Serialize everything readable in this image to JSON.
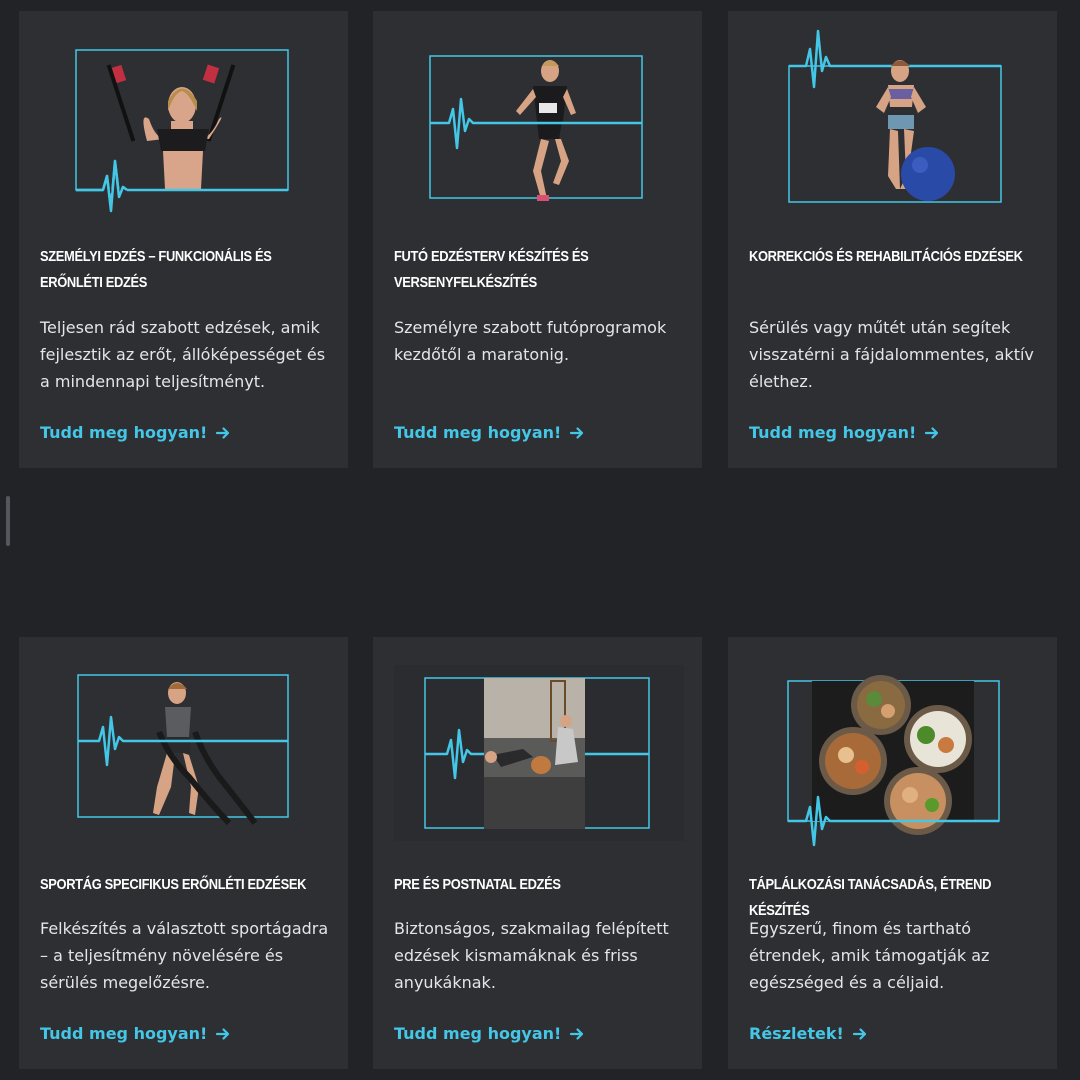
{
  "colors": {
    "background": "#222326",
    "card": "#2e2f33",
    "accent": "#44c6e6",
    "text": "#e4e5e8"
  },
  "cards": [
    {
      "title": "Személyi edzés – funkcionális és erőnléti edzés",
      "description": "Teljesen rád szabott edzések, amik fejlesztik az erőt, állóképességet és a mindennapi teljesítményt.",
      "link": "Tudd meg hogyan!",
      "icon": "arrow-right-icon"
    },
    {
      "title": "Futó edzésterv készítés és versenyfelkészítés",
      "description": "Személyre szabott futóprogramok kezdőtől a maratonig.",
      "link": "Tudd meg hogyan!",
      "icon": "arrow-right-icon"
    },
    {
      "title": "Korrekciós és rehabilitációs edzések",
      "description": "Sérülés vagy műtét után segítek visszatérni a fájdalommentes, aktív élethez.",
      "link": "Tudd meg hogyan!",
      "icon": "arrow-right-icon"
    },
    {
      "title": "Sportág specifikus erőnléti edzések",
      "description": "Felkészítés a választott sportágadra – a teljesítmény növelésére és sérülés megelőzésre.",
      "link": "Tudd meg hogyan!",
      "icon": "arrow-right-icon"
    },
    {
      "title": "Pre és postnatal edzés",
      "description": "Biztonságos, szakmailag felépített edzések kismamáknak és friss anyukáknak.",
      "link": "Tudd meg hogyan!",
      "icon": "arrow-right-icon"
    },
    {
      "title": "Táplálkozási tanácsadás, étrend készítés",
      "description": "Egyszerű, finom és tartható étrendek, amik támogatják az egészséged és a céljaid.",
      "link": "Részletek!",
      "icon": "arrow-right-icon"
    }
  ]
}
